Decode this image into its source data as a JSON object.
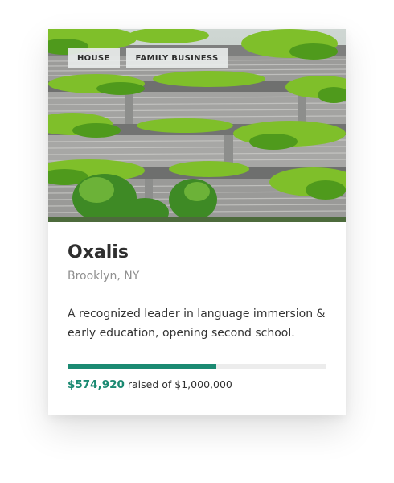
{
  "card": {
    "tags": [
      "HOUSE",
      "FAMILY BUSINESS"
    ],
    "title": "Oxalis",
    "location": "Brooklyn, NY",
    "description": "A recognized leader in language immersion & early education, opening second school.",
    "raised_amount": "$574,920",
    "raised_suffix": "raised of $1,000,000",
    "progress_fraction": 0.575,
    "accent_color": "#1b8a72"
  }
}
